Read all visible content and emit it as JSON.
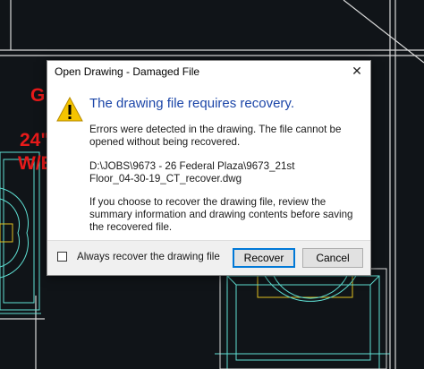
{
  "dialog": {
    "title": "Open Drawing - Damaged File",
    "close_glyph": "✕",
    "heading": "The drawing file requires recovery.",
    "message": "Errors were detected in the drawing. The file cannot be opened without being recovered.",
    "file_path": "D:\\JOBS\\9673 - 26 Federal Plaza\\9673_21st Floor_04-30-19_CT_recover.dwg",
    "advice": "If you choose to recover the drawing file, review the summary information and drawing contents before saving the recovered file.",
    "checkbox_label": "Always recover the drawing file",
    "checkbox_checked": false,
    "recover_label": "Recover",
    "cancel_label": "Cancel",
    "icon": "warning-icon"
  },
  "cad_labels": {
    "label_1": "G",
    "label_2": "24\"",
    "label_3": "W/E"
  },
  "colors": {
    "cad_background": "#101418",
    "cad_line_cyan": "#5fe0d4",
    "cad_line_white": "#d8d8d8",
    "cad_line_yellow": "#e0c020",
    "cad_text_red": "#e81a1a",
    "heading_blue": "#1c46a8",
    "accent_focus": "#0078d7"
  }
}
